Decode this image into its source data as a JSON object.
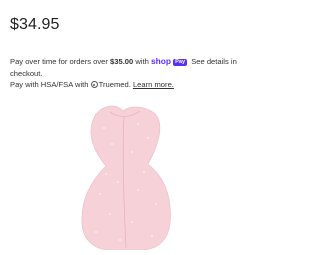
{
  "header": {
    "cut_text_left": "•••••",
    "cut_text_right": "•••"
  },
  "product": {
    "price": "$34.95",
    "image_alt": "Pink sleep sack"
  },
  "shop_pay": {
    "intro": "Pay over time for orders over ",
    "threshold": "$35.00",
    "with": " with ",
    "brand": "shop",
    "badge": "Pay",
    "outro": " See details in checkout."
  },
  "hsa": {
    "intro": "Pay with HSA/FSA with ",
    "brand": "Truemed.",
    "link": "Learn more."
  },
  "colors": {
    "shop_pay": "#5a31f4",
    "product_fabric": "#f6d2d8"
  }
}
